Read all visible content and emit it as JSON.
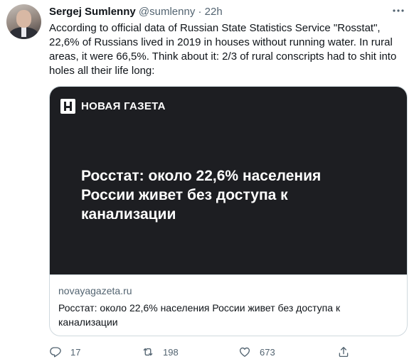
{
  "tweet": {
    "author_name": "Sergej Sumlenny",
    "handle": "@sumlenny",
    "separator": "·",
    "time": "22h",
    "text_lines": [
      "According to official data of Russian State Statistics Service \"Rosstat\",",
      "22,6% of Russians lived in 2019 in houses without running water. In rural",
      "areas, it were 66,5%. Think about it: 2/3 of rural conscripts had to shit into",
      "holes all their life long:"
    ]
  },
  "card": {
    "brand": "НОВАЯ ГАЗЕТА",
    "headline_lines": [
      "Росстат: около 22,6% населения",
      "России живет без доступа к",
      "канализации"
    ],
    "domain": "novayagazeta.ru",
    "title_lines": [
      "Росстат: около 22,6% населения России живет без доступа к",
      "канализации"
    ]
  },
  "actions": {
    "reply_count": "17",
    "retweet_count": "198",
    "like_count": "673"
  },
  "icons": {
    "more": "more-icon",
    "reply": "reply-icon",
    "retweet": "retweet-icon",
    "like": "heart-icon",
    "share": "share-icon"
  },
  "colors": {
    "text": "#0f1419",
    "secondary": "#536471",
    "border": "#cfd9de",
    "card_media_bg": "#1d1e22"
  }
}
